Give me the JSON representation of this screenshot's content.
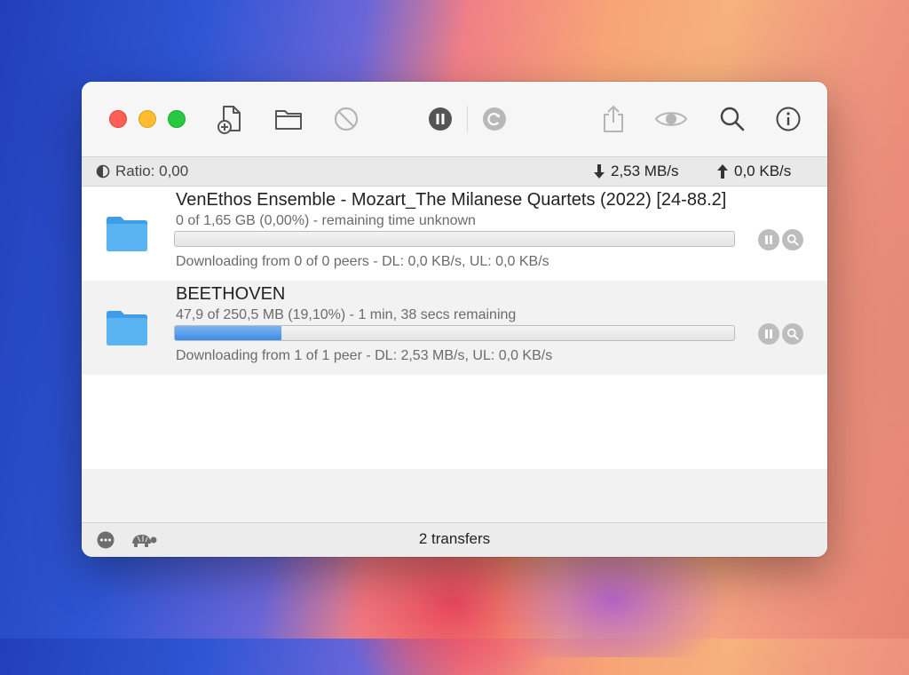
{
  "toolbar": {
    "buttons": [
      {
        "name": "open-torrent",
        "icon": "document-plus-icon"
      },
      {
        "name": "open-folder",
        "icon": "folder-icon"
      },
      {
        "name": "remove",
        "icon": "prohibit-icon"
      },
      {
        "name": "pause-all",
        "icon": "pause-circle-icon"
      },
      {
        "name": "resume-all",
        "icon": "refresh-circle-icon"
      },
      {
        "name": "share",
        "icon": "share-icon"
      },
      {
        "name": "quick-look",
        "icon": "eye-icon"
      },
      {
        "name": "filter",
        "icon": "magnifier-icon"
      },
      {
        "name": "inspector",
        "icon": "info-icon"
      }
    ]
  },
  "status": {
    "ratio": "Ratio: 0,00",
    "download_speed": "2,53 MB/s",
    "upload_speed": "0,0 KB/s"
  },
  "transfers": [
    {
      "name": "VenEthos Ensemble - Mozart_The Milanese Quartets (2022) [24-88.2]",
      "progress_text": "0 of 1,65 GB (0,00%) - remaining time unknown",
      "progress": 0.0,
      "status_text": "Downloading from 0 of 0 peers - DL: 0,0 KB/s, UL: 0,0 KB/s"
    },
    {
      "name": "BEETHOVEN",
      "progress_text": "47,9 of 250,5 MB (19,10%) - 1 min, 38 secs remaining",
      "progress": 0.191,
      "status_text": "Downloading from 1 of 1 peer - DL: 2,53 MB/s, UL: 0,0 KB/s"
    }
  ],
  "footer": {
    "count": "2 transfers"
  },
  "colors": {
    "progress_fill": "#3d8be6",
    "folder": "#5ab4f2"
  }
}
